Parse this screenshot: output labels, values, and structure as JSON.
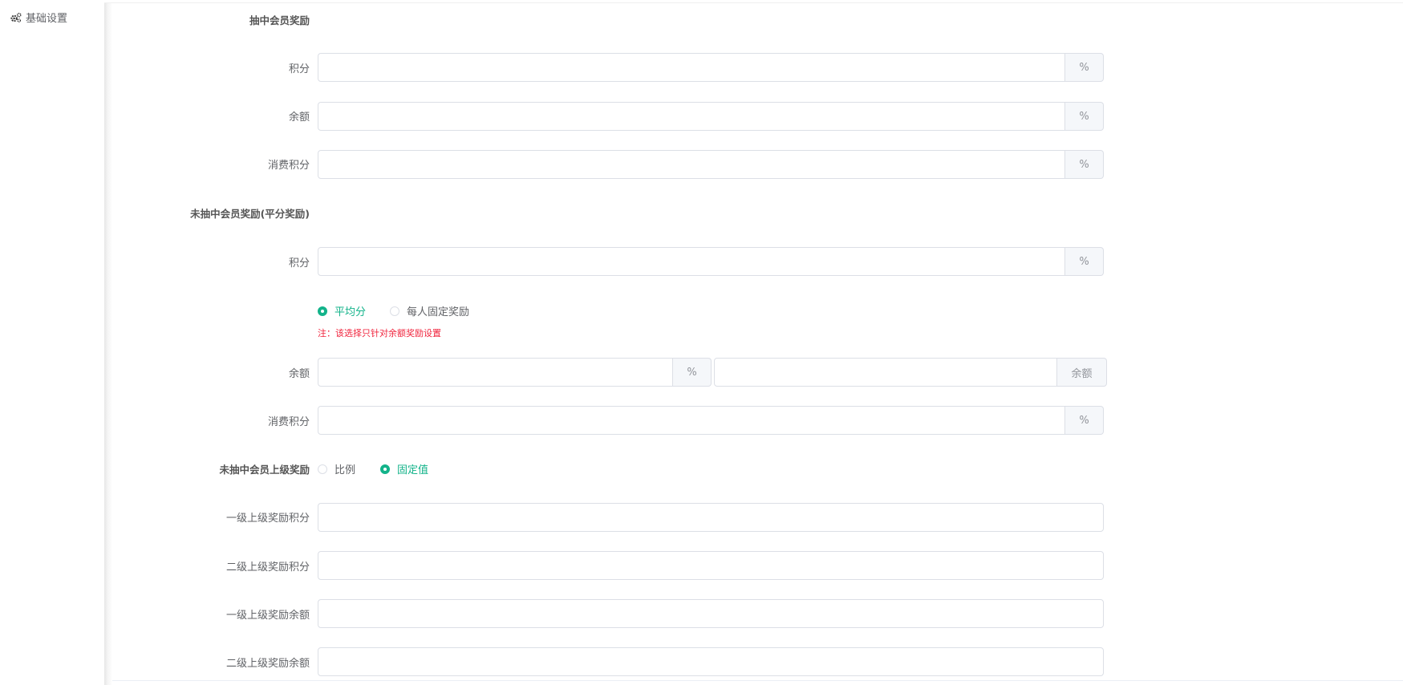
{
  "sidebar": {
    "items": [
      {
        "label": "基础设置",
        "icon": "gears-icon"
      }
    ]
  },
  "sections": {
    "winner_title": "抽中会员奖励",
    "nonwinner_title": "未抽中会员奖励(平分奖励)",
    "superior_title": "未抽中会员上级奖励"
  },
  "fields": {
    "winner_points_label": "积分",
    "winner_balance_label": "余额",
    "winner_consume_label": "消费积分",
    "nonwinner_points_label": "积分",
    "nonwinner_balance_label": "余额",
    "nonwinner_consume_label": "消费积分",
    "level1_points_label": "一级上级奖励积分",
    "level2_points_label": "二级上级奖励积分",
    "level1_balance_label": "一级上级奖励余额",
    "level2_balance_label": "二级上级奖励余额"
  },
  "suffix": {
    "percent": "%",
    "balance": "余额"
  },
  "distribution": {
    "options": [
      {
        "label": "平均分",
        "checked": true
      },
      {
        "label": "每人固定奖励",
        "checked": false
      }
    ],
    "note": "注：该选择只针对余额奖励设置"
  },
  "superior_mode": {
    "options": [
      {
        "label": "比例",
        "checked": false
      },
      {
        "label": "固定值",
        "checked": true
      }
    ]
  },
  "colors": {
    "accent": "#13b38a",
    "note": "#f0233c"
  }
}
